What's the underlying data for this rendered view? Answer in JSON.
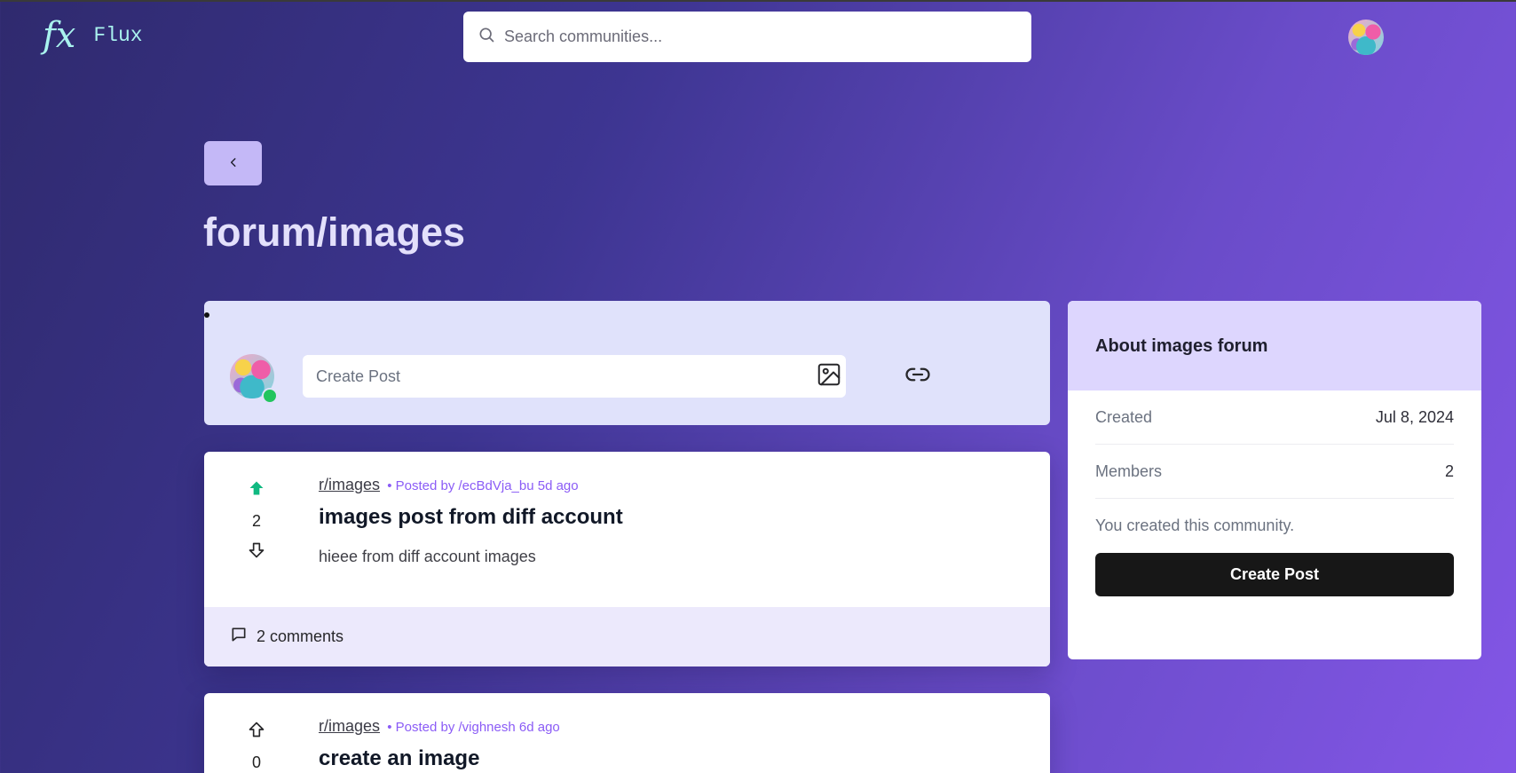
{
  "header": {
    "logo_mark": "fx",
    "app_name": "Flux",
    "search_placeholder": "Search communities..."
  },
  "page": {
    "title": "forum/images"
  },
  "create_post": {
    "placeholder": "Create Post",
    "online_status_color": "#22c55e"
  },
  "posts": [
    {
      "community": "r/images",
      "meta": "• Posted by /ecBdVja_bu 5d ago",
      "title": "images post from diff account",
      "body": "hieee from diff account images",
      "score": "2",
      "upvoted": true,
      "comments": "2 comments"
    },
    {
      "community": "r/images",
      "meta": "• Posted by /vighnesh 6d ago",
      "title": "create an image",
      "score": "0",
      "upvoted": false
    }
  ],
  "sidebar": {
    "title": "About images forum",
    "created_label": "Created",
    "created_value": "Jul 8, 2024",
    "members_label": "Members",
    "members_value": "2",
    "note": "You created this community.",
    "button_label": "Create Post"
  },
  "colors": {
    "accent": "#8b5cf6",
    "upvote": "#10b981",
    "logo": "#a9f2ee"
  }
}
